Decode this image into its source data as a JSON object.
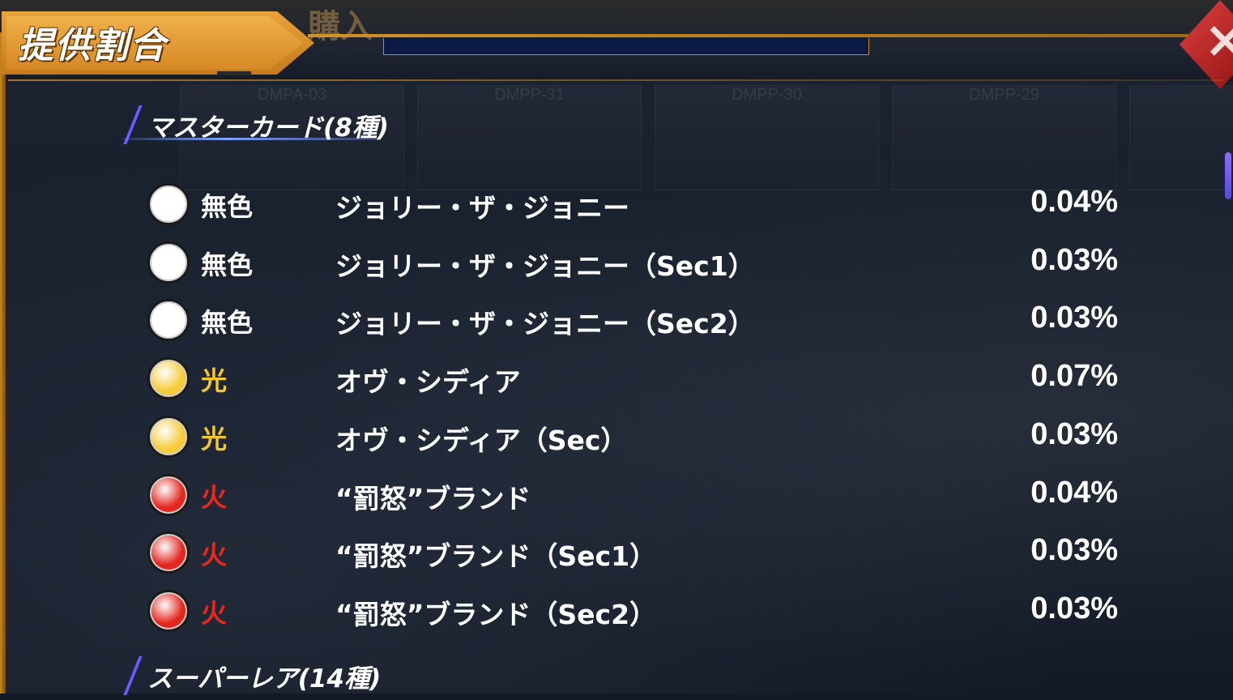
{
  "header": {
    "title": "提供割合",
    "background_partial_label": "購入"
  },
  "background_boxes": [
    "DMPA-03",
    "DMPP-31",
    "DMPP-30",
    "DMPP-29",
    ""
  ],
  "close_button": {
    "label": "×"
  },
  "colors": {
    "colorless": "#ffffff",
    "light": "#f6cc3a",
    "fire": "#e3271e",
    "light_text": "#f2c630",
    "fire_text": "#e8281c",
    "colorless_text": "#ffffff"
  },
  "sections": [
    {
      "label": "マスターカード(8種)",
      "rows": [
        {
          "civ": "無色",
          "civ_key": "colorless",
          "name": "ジョリー・ザ・ジョニー",
          "rate": "0.04%"
        },
        {
          "civ": "無色",
          "civ_key": "colorless",
          "name": "ジョリー・ザ・ジョニー（Sec1）",
          "rate": "0.03%"
        },
        {
          "civ": "無色",
          "civ_key": "colorless",
          "name": "ジョリー・ザ・ジョニー（Sec2）",
          "rate": "0.03%"
        },
        {
          "civ": "光",
          "civ_key": "light",
          "name": "オヴ・シディア",
          "rate": "0.07%"
        },
        {
          "civ": "光",
          "civ_key": "light",
          "name": "オヴ・シディア（Sec）",
          "rate": "0.03%"
        },
        {
          "civ": "火",
          "civ_key": "fire",
          "name": "“罰怒”ブランド",
          "rate": "0.04%"
        },
        {
          "civ": "火",
          "civ_key": "fire",
          "name": "“罰怒”ブランド（Sec1）",
          "rate": "0.03%"
        },
        {
          "civ": "火",
          "civ_key": "fire",
          "name": "“罰怒”ブランド（Sec2）",
          "rate": "0.03%"
        }
      ]
    },
    {
      "label": "スーパーレア(14種)",
      "rows": []
    }
  ]
}
